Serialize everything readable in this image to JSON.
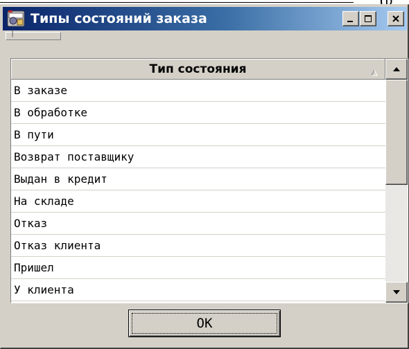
{
  "background": {
    "fragment_text": "(p"
  },
  "window": {
    "title": "Типы состояний заказа",
    "controls": {
      "minimize": "minimize-icon",
      "maximize": "maximize-icon",
      "close": "close-icon"
    },
    "toolbar_handle_text": "│"
  },
  "grid": {
    "column_header": "Тип состояния",
    "rows": [
      "В заказе",
      "В обработке",
      "В пути",
      "Возврат поставщику",
      "Выдан в кредит",
      "На складе",
      "Отказ",
      "Отказ клиента",
      "Пришел",
      "У клиента"
    ],
    "scroll_position": 0
  },
  "buttons": {
    "ok_label": "OK"
  },
  "colors": {
    "title_gradient_start": "#0a246a",
    "title_gradient_end": "#a6caf0",
    "face": "#d4d0c8"
  }
}
